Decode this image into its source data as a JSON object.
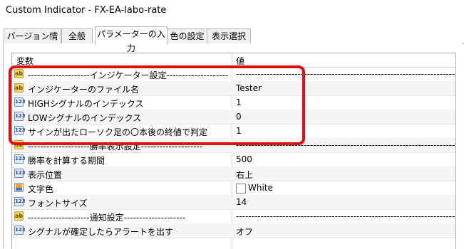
{
  "window": {
    "title": "Custom Indicator - FX-EA-labo-rate"
  },
  "tabs": [
    {
      "label": "バージョン情報",
      "active": false
    },
    {
      "label": "全般",
      "active": false
    },
    {
      "label": "パラメーターの入力",
      "active": true
    },
    {
      "label": "色の設定",
      "active": false
    },
    {
      "label": "表示選択",
      "active": false
    }
  ],
  "grid": {
    "headers": {
      "variable": "変数",
      "value": "値"
    },
    "rows": [
      {
        "icon": "ab-icon",
        "name": "--------------------インジケーター設定--------------------",
        "value": "------------------------------------------------------------------------"
      },
      {
        "icon": "ab-icon",
        "name": "インジケーターのファイル名",
        "value": "Tester"
      },
      {
        "icon": "numeric-icon",
        "name": "HIGHシグナルのインデックス",
        "value": "1"
      },
      {
        "icon": "numeric-icon",
        "name": "LOWシグナルのインデックス",
        "value": "0"
      },
      {
        "icon": "numeric-icon",
        "name": "サインが出たローソク足の〇本後の終値で判定",
        "value": "1"
      },
      {
        "icon": "ab-icon",
        "name": "--------------------勝率表示設定--------------------",
        "value": "------------------------------------------------------------------------"
      },
      {
        "icon": "numeric-icon",
        "name": "勝率を計算する期間",
        "value": "500"
      },
      {
        "icon": "numeric-icon",
        "name": "表示位置",
        "value": "右上"
      },
      {
        "icon": "color-icon",
        "name": "文字色",
        "value": "White"
      },
      {
        "icon": "numeric-icon",
        "name": "フォントサイズ",
        "value": "14"
      },
      {
        "icon": "ab-icon",
        "name": "--------------------通知設定--------------------",
        "value": "------------------------------------------------------------------------"
      },
      {
        "icon": "numeric-icon",
        "name": "シグナルが確定したらアラートを出す",
        "value": "オフ"
      }
    ]
  },
  "colors": {
    "highlight": "#e01010",
    "text_color_swatch": "#ffffff"
  }
}
